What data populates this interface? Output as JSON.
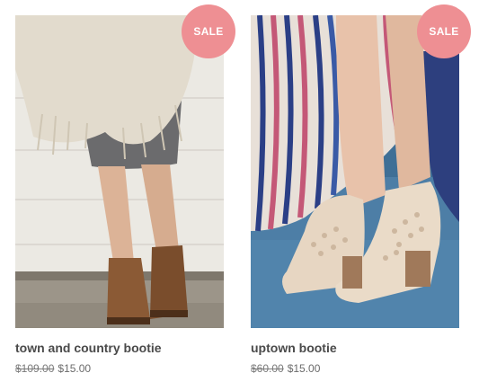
{
  "products": [
    {
      "badge": "SALE",
      "title": "town and country bootie",
      "old_price": "$109.00",
      "new_price": "$15.00",
      "image_icon": "product-photo-brown-ankle-boots"
    },
    {
      "badge": "SALE",
      "title": "uptown bootie",
      "old_price": "$60.00",
      "new_price": "$15.00",
      "image_icon": "product-photo-tan-peep-toe-booties"
    }
  ],
  "colors": {
    "badge": "#ee8f93",
    "title": "#4a4a4a",
    "price": "#6b6b6b"
  }
}
